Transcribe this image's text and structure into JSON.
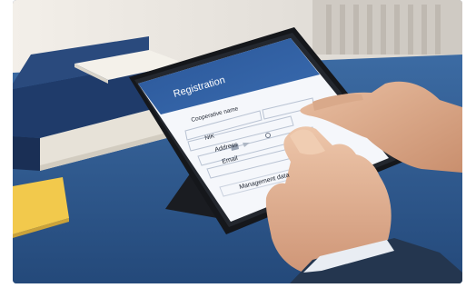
{
  "screen": {
    "title": "Registration",
    "fields": {
      "cooperative_name": "Cooperative name",
      "nik": "NIK",
      "address": "Address",
      "email": "Email",
      "management_data": "Management data"
    }
  },
  "colors": {
    "screen_header": "#2d5a98",
    "desk": "#2f5a8f",
    "tablet_bezel": "#1d2026",
    "form_bg": "#f5f7fb"
  }
}
